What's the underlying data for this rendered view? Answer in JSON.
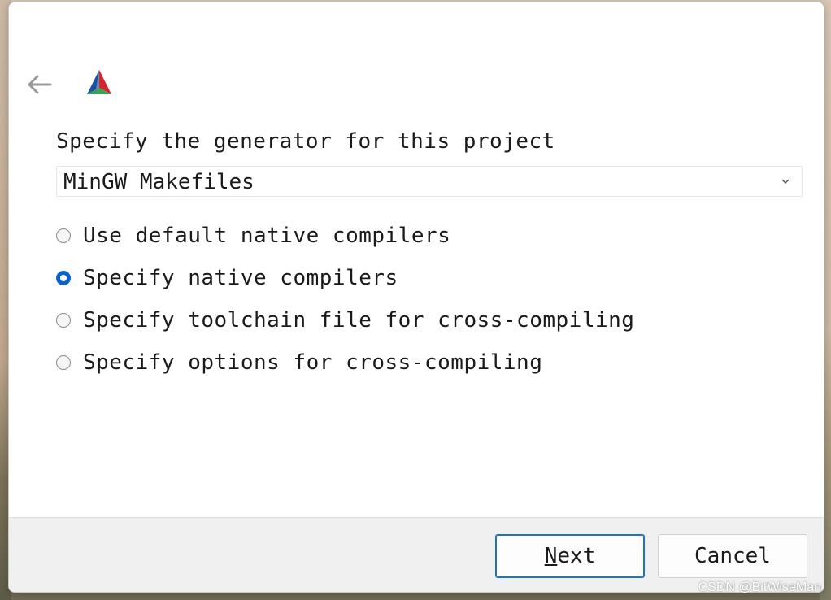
{
  "dialog": {
    "prompt": "Specify the generator for this project",
    "generator": {
      "selected": "MinGW Makefiles"
    },
    "options": [
      {
        "label": "Use default native compilers",
        "checked": false
      },
      {
        "label": "Specify native compilers",
        "checked": true
      },
      {
        "label": "Specify toolchain file for cross-compiling",
        "checked": false
      },
      {
        "label": "Specify options for cross-compiling",
        "checked": false
      }
    ],
    "buttons": {
      "next_mnemonic": "N",
      "next_rest": "ext",
      "cancel": "Cancel"
    }
  },
  "icons": {
    "back": "back-arrow-icon",
    "logo": "cmake-logo-icon",
    "dropdown": "chevron-down-icon"
  },
  "watermark": "CSDN @BitWiseMan",
  "colors": {
    "accent": "#0a63c9",
    "footer_bg": "#f0f0f0",
    "logo_blue": "#1e4fa0",
    "logo_red": "#d1262a",
    "logo_green": "#3aa35b"
  }
}
